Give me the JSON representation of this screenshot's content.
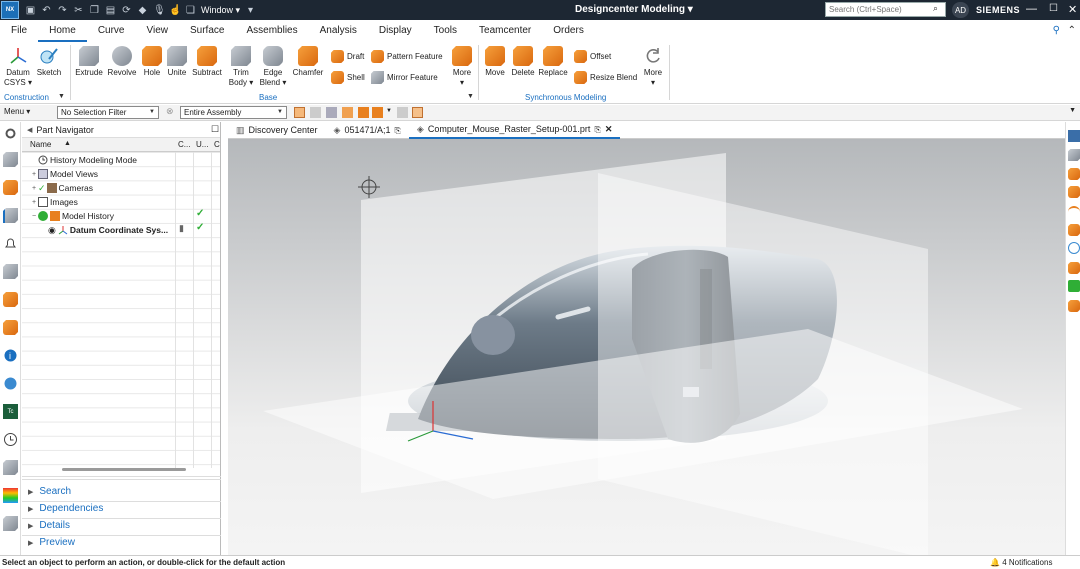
{
  "titlebar": {
    "logo": "NX",
    "window_label": "Window ▾",
    "title": "Designcenter  Modeling ▾",
    "search_placeholder": "Search (Ctrl+Space)",
    "user_initials": "AD",
    "brand": "SIEMENS"
  },
  "menu_tabs": [
    "File",
    "Home",
    "Curve",
    "View",
    "Surface",
    "Assemblies",
    "Analysis",
    "Display",
    "Tools",
    "Teamcenter",
    "Orders"
  ],
  "active_tab": "Home",
  "ribbon": {
    "construction": {
      "label": "Construction",
      "datum": "Datum\nCSYS ▾",
      "sketch": "Sketch"
    },
    "base": {
      "label": "Base",
      "extrude": "Extrude",
      "revolve": "Revolve",
      "hole": "Hole",
      "unite": "Unite",
      "subtract": "Subtract",
      "trim_body": "Trim\nBody ▾",
      "edge_blend": "Edge\nBlend ▾",
      "chamfer": "Chamfer",
      "draft": "Draft",
      "shell": "Shell",
      "pattern_feature": "Pattern Feature",
      "mirror_feature": "Mirror Feature",
      "more": "More\n▾"
    },
    "synchronous": {
      "label": "Synchronous Modeling",
      "move": "Move",
      "delete": "Delete",
      "replace": "Replace",
      "offset": "Offset",
      "resize_blend": "Resize Blend",
      "more": "More\n▾"
    }
  },
  "toolbar": {
    "menu": "Menu ▾",
    "selection_filter": "No Selection Filter",
    "scope": "Entire Assembly"
  },
  "navigator": {
    "title": "Part Navigator",
    "col_name": "Name",
    "col_c": "C...",
    "col_u": "U...",
    "col_c2": "C",
    "items": [
      {
        "label": "History Modeling Mode",
        "bold": false
      },
      {
        "label": "Model Views",
        "bold": false
      },
      {
        "label": "Cameras",
        "bold": false
      },
      {
        "label": "Images",
        "bold": false
      },
      {
        "label": "Model History",
        "bold": false
      },
      {
        "label": "Datum Coordinate Sys...",
        "bold": true
      }
    ],
    "sections": [
      "Search",
      "Dependencies",
      "Details",
      "Preview"
    ]
  },
  "graphics_tabs": [
    {
      "label": "Discovery Center"
    },
    {
      "label": "051471/A;1"
    },
    {
      "label": "Computer_Mouse_Raster_Setup-001.prt"
    }
  ],
  "status": {
    "message": "Select an object to perform an action, or double-click for the default action",
    "notifications": "4 Notifications"
  },
  "colors": {
    "accent": "#1a6fc0",
    "titlebar": "#1d2733",
    "check": "#2fae36",
    "orange": "#e8801f"
  }
}
